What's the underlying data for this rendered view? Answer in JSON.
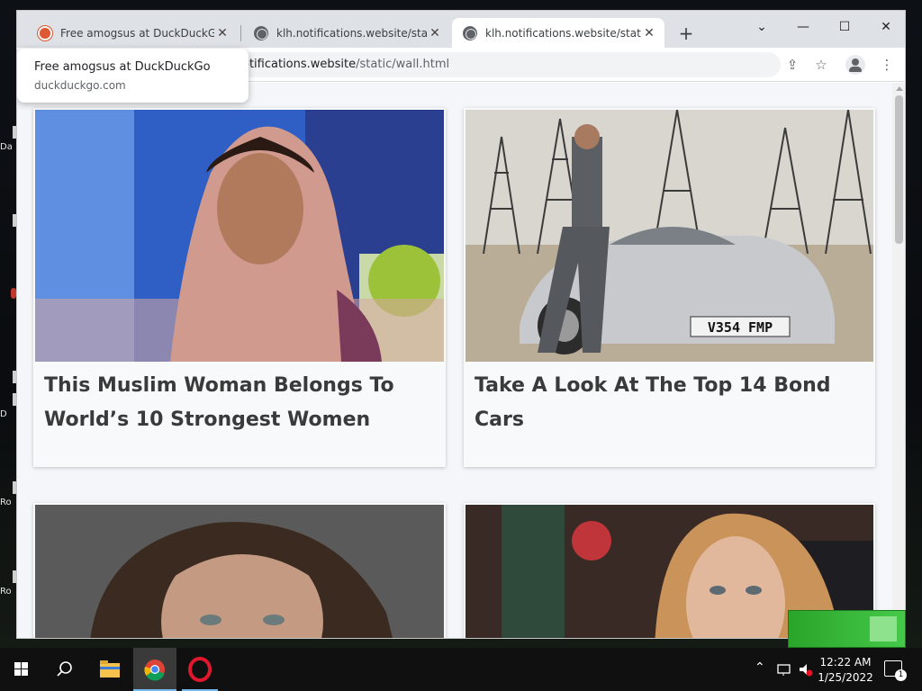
{
  "browser": {
    "tabs": [
      {
        "title": "Free amogsus at DuckDuckGo",
        "favicon": "duckduckgo-icon",
        "active": false
      },
      {
        "title": "klh.notifications.website/static/w",
        "favicon": "globe-icon",
        "active": false
      },
      {
        "title": "klh.notifications.website/static/w",
        "favicon": "globe-icon",
        "active": true
      }
    ],
    "new_tab_label": "+",
    "window_controls": {
      "tab_search": "⌄",
      "minimize": "—",
      "maximize": "☐",
      "close": "✕"
    },
    "url_visible_part": "otifications.website",
    "url_path": "/static/wall.html",
    "hover_card": {
      "title": "Free amogsus at DuckDuckGo",
      "domain": "duckduckgo.com"
    }
  },
  "page": {
    "cards": [
      {
        "headline_line1": "This Muslim Woman Belongs To",
        "headline_line2": "World’s 10 Strongest Women"
      },
      {
        "headline_line1": "Take A Look At The Top 14 Bond Cars",
        "headline_line2": ""
      },
      {
        "headline_line1": "",
        "headline_line2": ""
      },
      {
        "headline_line1": "",
        "headline_line2": ""
      }
    ],
    "plate_text": "V354 FMP"
  },
  "taskbar": {
    "time": "12:22 AM",
    "date": "1/25/2022",
    "notification_count": "1"
  },
  "desktop_labels": [
    "Da",
    "D",
    "Ro",
    "Ro"
  ],
  "colors": {
    "chrome_tabstrip": "#dee1e6",
    "duckduckgo_orange": "#de5833",
    "taskbar": "#101010"
  }
}
